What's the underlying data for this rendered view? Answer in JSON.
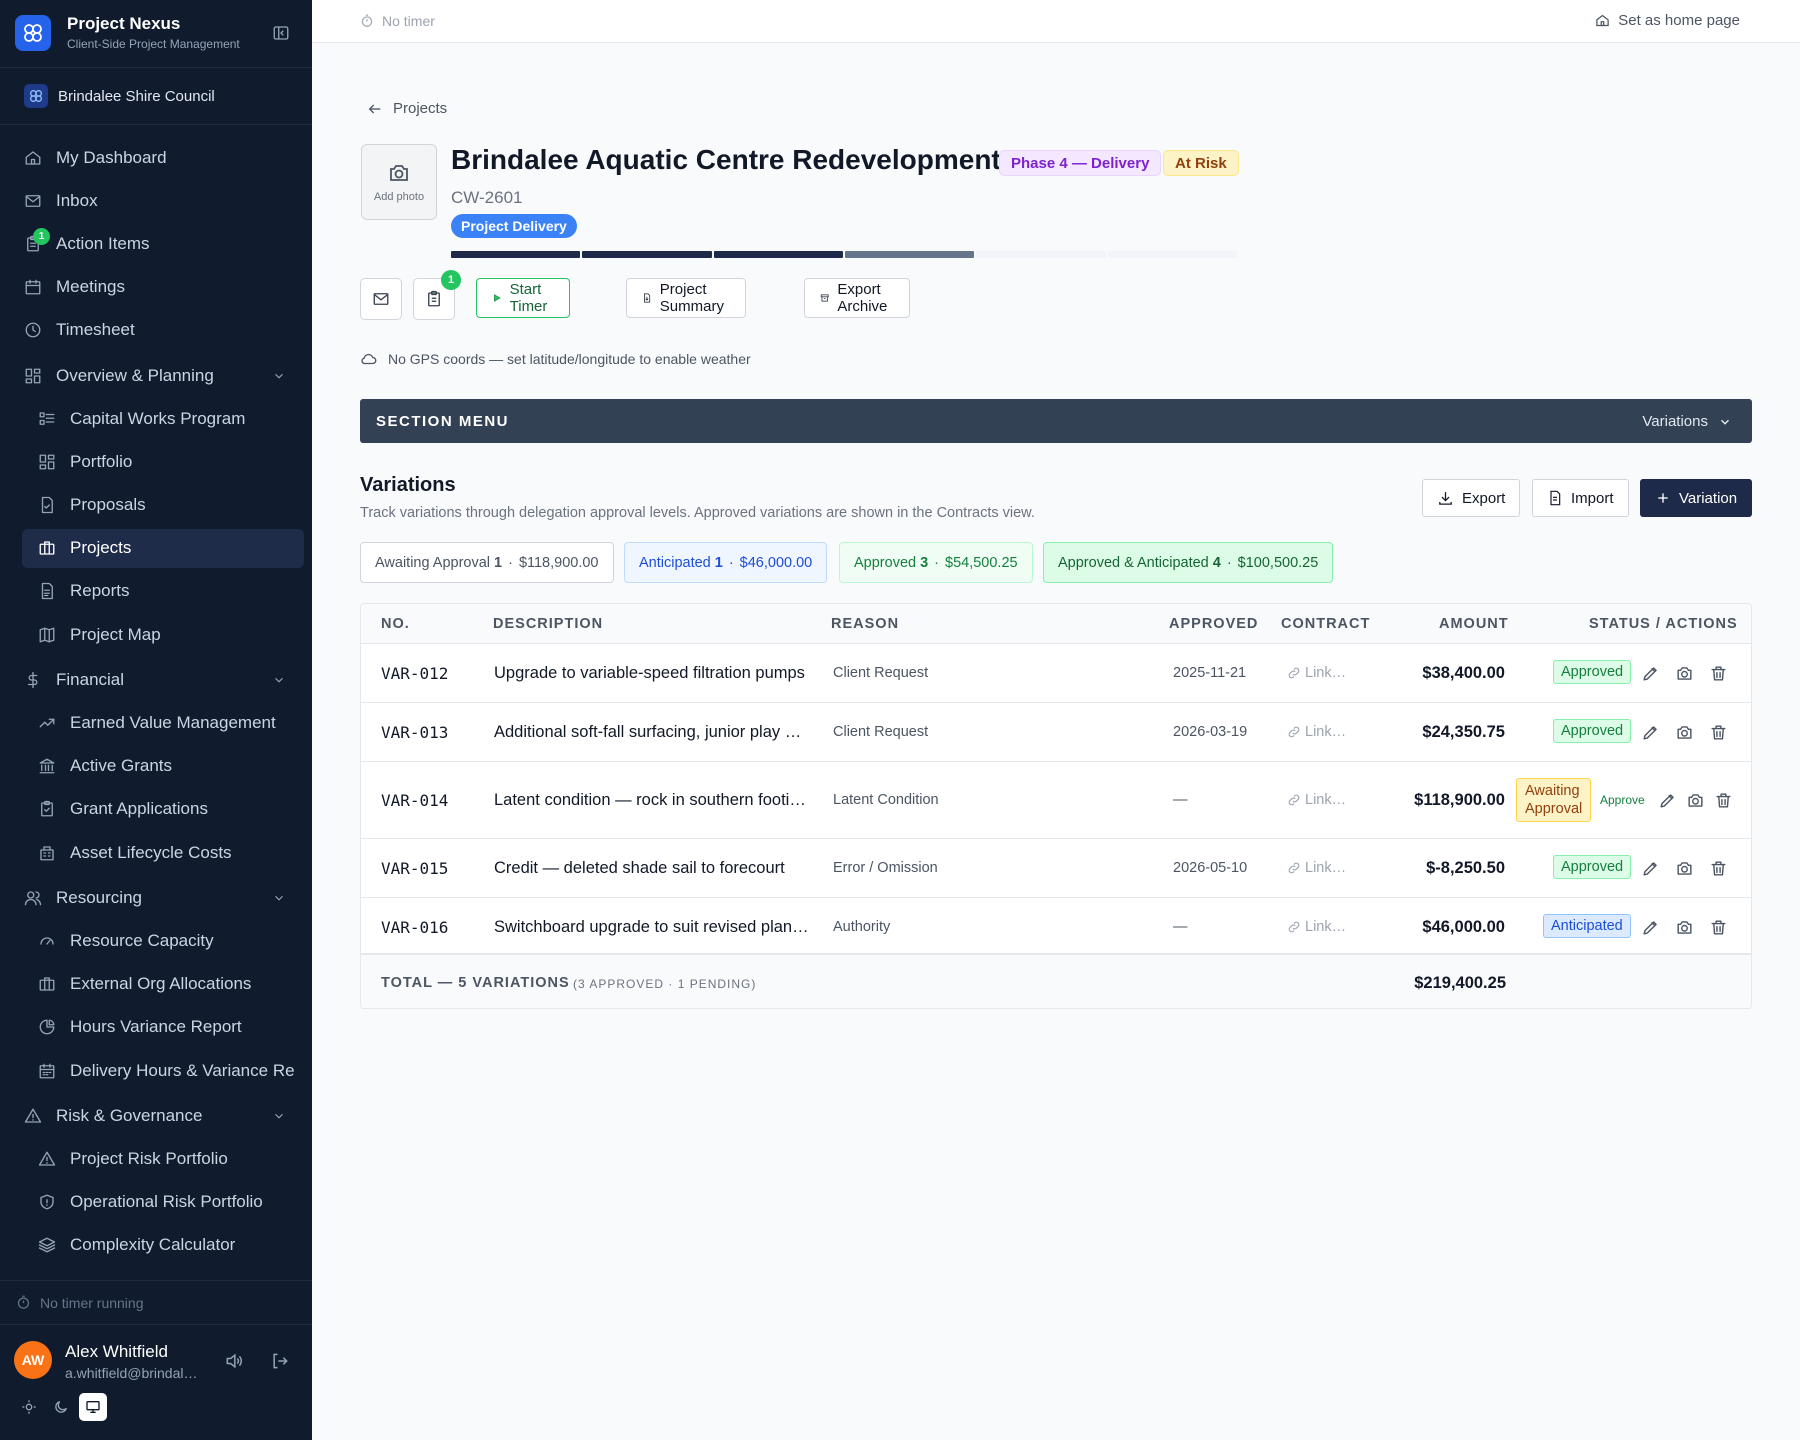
{
  "app": {
    "name": "Project Nexus",
    "tagline": "Client-Side Project Management",
    "organization": "Brindalee Shire Council"
  },
  "sidebar": {
    "items": [
      {
        "label": "My Dashboard",
        "icon": "home-icon"
      },
      {
        "label": "Inbox",
        "icon": "mail-icon"
      },
      {
        "label": "Action Items",
        "icon": "clipboard-icon",
        "badge": "1"
      },
      {
        "label": "Meetings",
        "icon": "calendar-icon"
      },
      {
        "label": "Timesheet",
        "icon": "clock-icon"
      },
      {
        "label": "Overview & Planning",
        "icon": "layout-icon",
        "group": true
      },
      {
        "label": "Capital Works Program",
        "icon": "list-icon",
        "sub": true
      },
      {
        "label": "Portfolio",
        "icon": "grid-icon",
        "sub": true
      },
      {
        "label": "Proposals",
        "icon": "file-icon",
        "sub": true
      },
      {
        "label": "Projects",
        "icon": "briefcase-icon",
        "sub": true,
        "active": true
      },
      {
        "label": "Reports",
        "icon": "document-icon",
        "sub": true
      },
      {
        "label": "Project Map",
        "icon": "map-icon",
        "sub": true
      },
      {
        "label": "Financial",
        "icon": "dollar-icon",
        "group": true
      },
      {
        "label": "Earned Value Management",
        "icon": "trend-icon",
        "sub": true
      },
      {
        "label": "Active Grants",
        "icon": "bank-icon",
        "sub": true
      },
      {
        "label": "Grant Applications",
        "icon": "clipboard-check-icon",
        "sub": true
      },
      {
        "label": "Asset Lifecycle Costs",
        "icon": "building-icon",
        "sub": true
      },
      {
        "label": "Resourcing",
        "icon": "users-icon",
        "group": true
      },
      {
        "label": "Resource Capacity",
        "icon": "gauge-icon",
        "sub": true
      },
      {
        "label": "External Org Allocations",
        "icon": "briefcase-icon",
        "sub": true
      },
      {
        "label": "Hours Variance Report",
        "icon": "pie-icon",
        "sub": true
      },
      {
        "label": "Delivery Hours & Variance Re",
        "icon": "calendar-grid-icon",
        "sub": true
      },
      {
        "label": "Risk & Governance",
        "icon": "warning-icon",
        "group": true
      },
      {
        "label": "Project Risk Portfolio",
        "icon": "warning-icon",
        "sub": true
      },
      {
        "label": "Operational Risk Portfolio",
        "icon": "shield-icon",
        "sub": true
      },
      {
        "label": "Complexity Calculator",
        "icon": "layers-icon",
        "sub": true
      }
    ],
    "timer_status": "No timer running",
    "user": {
      "initials": "AW",
      "name": "Alex Whitfield",
      "email": "a.whitfield@brindal…"
    }
  },
  "topbar": {
    "timer": "No timer",
    "home_link": "Set as home page"
  },
  "project": {
    "back_label": "Projects",
    "photo_label": "Add photo",
    "title": "Brindalee Aquatic Centre Redevelopment",
    "phase": "Phase 4 — Delivery",
    "risk": "At Risk",
    "code": "CW-2601",
    "stage": "Project Delivery",
    "progress_segments": [
      "done",
      "done",
      "done",
      "current",
      "todo",
      "todo"
    ],
    "notification_count": "1",
    "buttons": {
      "start_timer": "Start Timer",
      "summary": "Project Summary",
      "export_archive": "Export Archive"
    },
    "gps_note": "No GPS coords — set latitude/longitude to enable weather"
  },
  "section_menu": {
    "label": "SECTION MENU",
    "selected": "Variations"
  },
  "variations": {
    "title": "Variations",
    "subtitle": "Track variations through delegation approval levels. Approved variations are shown in the Contracts view.",
    "actions": {
      "export": "Export",
      "import": "Import",
      "add": "Variation"
    },
    "chips": [
      {
        "label": "Awaiting Approval",
        "count": "1",
        "amount": "$118,900.00"
      },
      {
        "label": "Anticipated",
        "count": "1",
        "amount": "$46,000.00"
      },
      {
        "label": "Approved",
        "count": "3",
        "amount": "$54,500.25"
      },
      {
        "label": "Approved & Anticipated",
        "count": "4",
        "amount": "$100,500.25"
      }
    ],
    "columns": [
      "NO.",
      "DESCRIPTION",
      "REASON",
      "APPROVED",
      "CONTRACT",
      "AMOUNT",
      "STATUS / ACTIONS"
    ],
    "rows": [
      {
        "no": "VAR-012",
        "description": "Upgrade to variable-speed filtration pumps",
        "reason": "Client Request",
        "approved": "2025-11-21",
        "contract": "Link…",
        "amount": "$38,400.00",
        "status": "Approved"
      },
      {
        "no": "VAR-013",
        "description": "Additional soft-fall surfacing, junior play …",
        "reason": "Client Request",
        "approved": "2026-03-19",
        "contract": "Link…",
        "amount": "$24,350.75",
        "status": "Approved"
      },
      {
        "no": "VAR-014",
        "description": "Latent condition — rock in southern footi…",
        "reason": "Latent Condition",
        "approved": "—",
        "contract": "Link…",
        "amount": "$118,900.00",
        "status": "Awaiting Approval",
        "status_line1": "Awaiting",
        "status_line2": "Approval",
        "approve_label": "Approve"
      },
      {
        "no": "VAR-015",
        "description": "Credit — deleted shade sail to forecourt",
        "reason": "Error / Omission",
        "approved": "2026-05-10",
        "contract": "Link…",
        "amount": "$-8,250.50",
        "status": "Approved"
      },
      {
        "no": "VAR-016",
        "description": "Switchboard upgrade to suit revised plan…",
        "reason": "Authority",
        "approved": "—",
        "contract": "Link…",
        "amount": "$46,000.00",
        "status": "Anticipated"
      }
    ],
    "total": {
      "label": "TOTAL — 5 VARIATIONS",
      "breakdown": "(3 APPROVED · 1 PENDING)",
      "amount": "$219,400.25"
    }
  },
  "colors": {
    "sidebar_bg": "#111b2e",
    "accent": "#3b82f6",
    "primary_btn": "#1e2a4a",
    "progress_done": "#1e2a4a",
    "progress_current": "#64748b",
    "progress_todo": "#f1f5f9"
  }
}
